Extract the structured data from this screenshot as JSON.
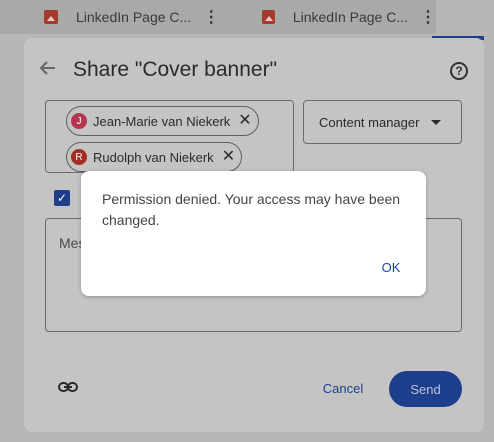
{
  "background": {
    "files": [
      {
        "name": "LinkedIn Page C..."
      },
      {
        "name": "LinkedIn Page C..."
      }
    ]
  },
  "share_dialog": {
    "title": "Share \"Cover banner\"",
    "help_icon_glyph": "?",
    "recipients": [
      {
        "initial": "J",
        "name": "Jean-Marie van Niekerk",
        "avatar_color": "#b5364f"
      },
      {
        "initial": "R",
        "name": "Rudolph van Niekerk",
        "avatar_color": "#a32d20"
      }
    ],
    "role": "Content manager",
    "notify_checked": true,
    "message_placeholder": "Mes",
    "cancel_label": "Cancel",
    "send_label": "Send"
  },
  "alert": {
    "message": "Permission denied. Your access may have been changed.",
    "ok_label": "OK"
  },
  "colors": {
    "accent": "#1d3e8a",
    "link_blue": "#1a47b8"
  }
}
